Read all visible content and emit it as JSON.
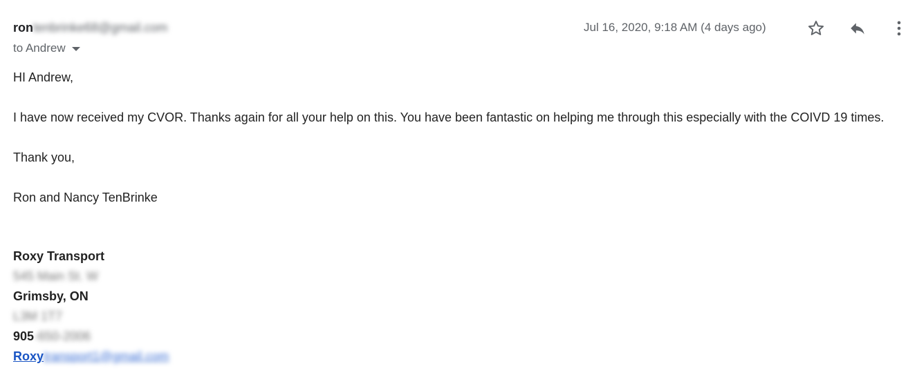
{
  "email": {
    "sender": {
      "name": "ron",
      "email_blurred": "tenbrinke68@gmail.com"
    },
    "recipient_label": "to Andrew",
    "date": "Jul 16, 2020, 9:18 AM (4 days ago)",
    "icons": {
      "star": "star-icon",
      "reply": "reply-icon",
      "more": "more-vertical-icon",
      "caret": "caret-down-icon"
    },
    "body": {
      "greeting": "HI Andrew,",
      "paragraph": "I have now received my CVOR. Thanks again for all your help on this. You have been fantastic on helping me through this especially with the COIVD 19 times.",
      "closing": "Thank you,",
      "sign_off": "Ron and Nancy TenBrinke"
    },
    "signature": {
      "company": "Roxy Transport",
      "street_blurred": "545 Main St. W",
      "city": "Grimsby, ON",
      "postal_blurred": "L3M 1T7",
      "phone_prefix": "905",
      "phone_rest_blurred": "-650-2006",
      "link_prefix": "Roxy",
      "link_rest_blurred": "transport1@gmail.com"
    },
    "colors": {
      "link": "#1a55c4",
      "muted": "#5f6368",
      "text": "#222222"
    }
  }
}
